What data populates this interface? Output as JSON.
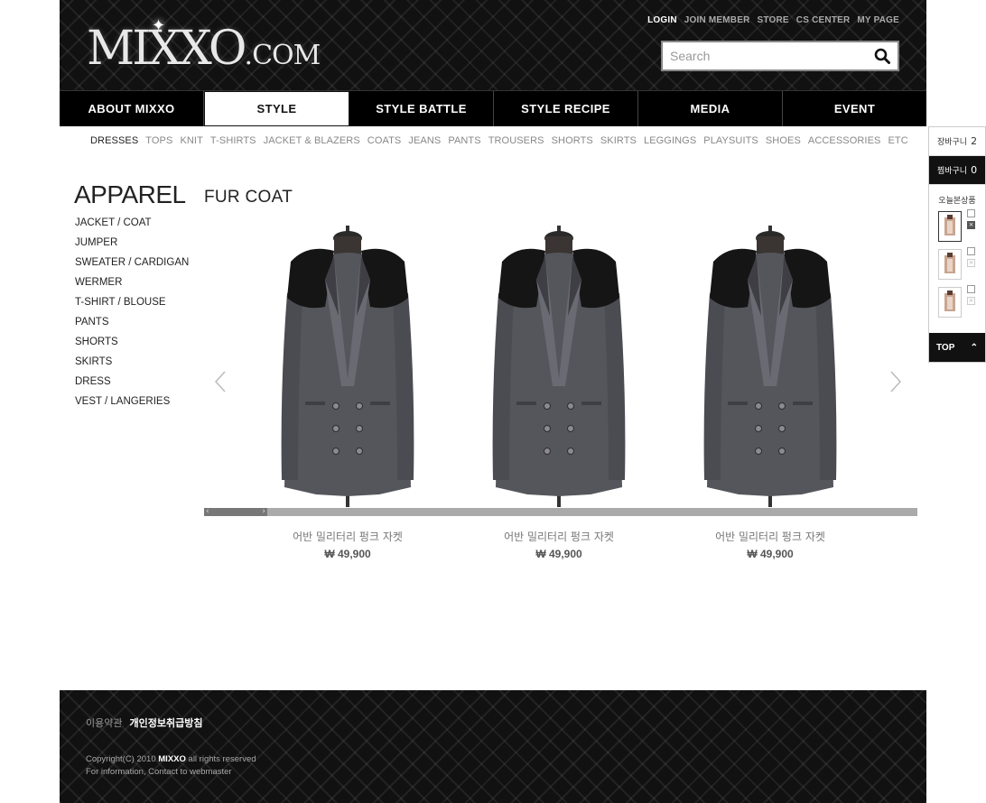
{
  "header": {
    "logo_main": "MIXXO",
    "logo_suffix": ".COM",
    "util_links": [
      "LOGIN",
      "JOIN MEMBER",
      "STORE",
      "CS CENTER",
      "MY PAGE"
    ],
    "search_placeholder": "Search"
  },
  "main_nav": {
    "tabs": [
      {
        "label": "ABOUT MIXXO"
      },
      {
        "label": "STYLE"
      },
      {
        "label": "STYLE BATTLE"
      },
      {
        "label": "STYLE RECIPE"
      },
      {
        "label": "MEDIA"
      },
      {
        "label": "EVENT"
      }
    ],
    "active_index": 1
  },
  "sub_nav": {
    "items": [
      "DRESSES",
      "TOPS",
      "KNIT",
      "T-SHIRTS",
      "JACKET & BLAZERS",
      "COATS",
      "JEANS",
      "PANTS",
      "TROUSERS",
      "SHORTS",
      "SKIRTS",
      "LEGGINGS",
      "PLAYSUITS",
      "SHOES",
      "ACCESSORIES",
      "ETC"
    ],
    "active_index": 0
  },
  "sidebar": {
    "title": "APPAREL",
    "items": [
      "JACKET / COAT",
      "JUMPER",
      "SWEATER / CARDIGAN",
      "WERMER",
      "T-SHIRT / BLOUSE",
      "PANTS",
      "SHORTS",
      "SKIRTS",
      "DRESS",
      "VEST / LANGERIES"
    ]
  },
  "content": {
    "title": "FUR COAT",
    "products": [
      {
        "name": "어반 밀리터리 펑크 자켓",
        "price": "₩ 49,900"
      },
      {
        "name": "어반 밀리터리 펑크 자켓",
        "price": "₩ 49,900"
      },
      {
        "name": "어반 밀리터리 펑크 자켓",
        "price": "₩ 49,900"
      }
    ],
    "scroll_position": 0.0
  },
  "quick_panel": {
    "cart_label": "장바구니",
    "cart_count": "2",
    "wish_label": "찜바구니",
    "wish_count": "0",
    "recent_title": "오늘본상품",
    "top_label": "TOP"
  },
  "footer": {
    "terms": "이용약관",
    "privacy": "개인정보취급방침",
    "copyright_prefix": "Copyright(C) 2010",
    "brand": "MIXXO",
    "copyright_suffix": "all rights reserved",
    "info": "For information, Contact to webmaster"
  },
  "colors": {
    "header_bg": "#111111",
    "nav_bg": "#000000",
    "coat_gray": "#55555c",
    "fur_black": "#151515"
  }
}
